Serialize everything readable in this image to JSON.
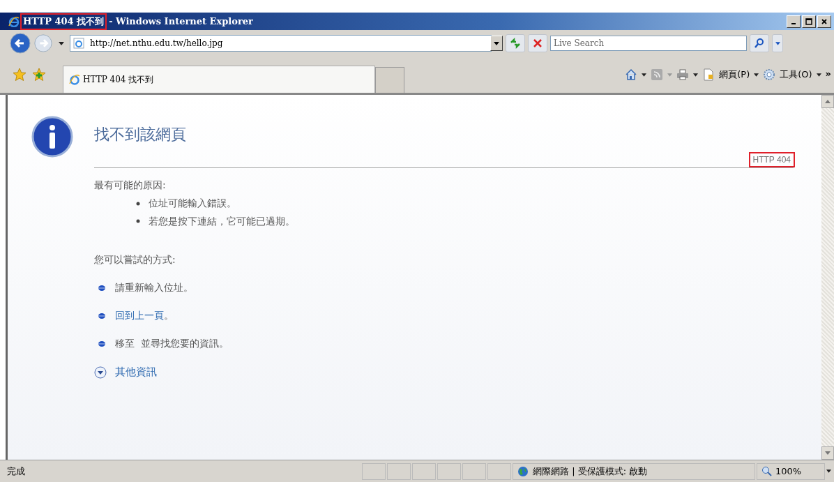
{
  "window": {
    "page_title": "HTTP 404 找不到",
    "app_title": "- Windows Internet Explorer",
    "page_title_highlighted": true
  },
  "address_bar": {
    "url": "http://net.nthu.edu.tw/hello.jpg"
  },
  "search": {
    "placeholder": "Live Search"
  },
  "tabs": [
    {
      "label": "HTTP 404 找不到",
      "selected": true
    }
  ],
  "command_bar": {
    "page_menu": "網頁(P)",
    "tools_menu": "工具(O)",
    "more": "»"
  },
  "content": {
    "heading": "找不到該網頁",
    "error_code": "HTTP 404",
    "error_code_highlighted": true,
    "causes_title": "最有可能的原因:",
    "causes": [
      "位址可能輸入錯誤。",
      "若您是按下連結，它可能已過期。"
    ],
    "try_title": "您可以嘗試的方式:",
    "actions": [
      {
        "kind": "text",
        "text": "請重新輸入位址。"
      },
      {
        "kind": "link",
        "text": "回到上一頁",
        "suffix": "。"
      },
      {
        "kind": "text",
        "text": "移至  並尋找您要的資訊。"
      }
    ],
    "more_info": "其他資訊"
  },
  "status_bar": {
    "status": "完成",
    "zone": "網際網路 | 受保護模式: 啟動",
    "zoom": "100%"
  }
}
